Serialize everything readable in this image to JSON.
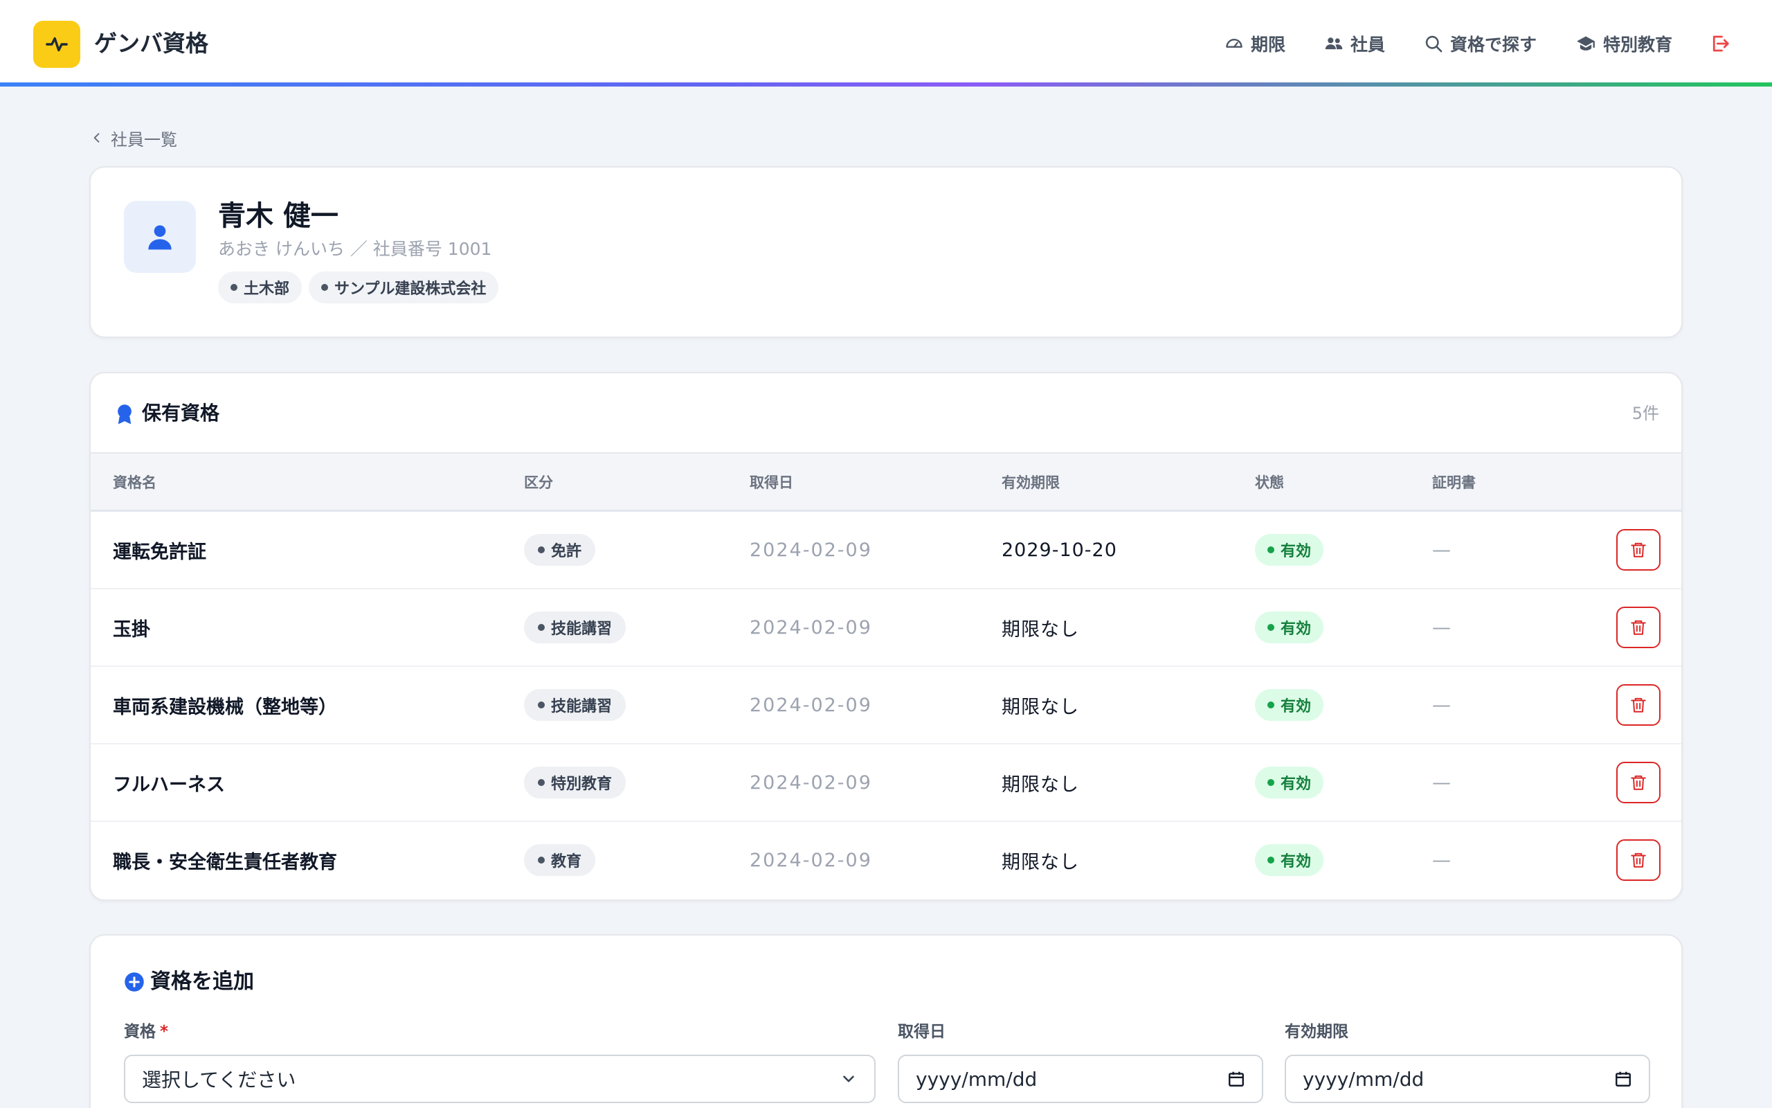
{
  "app": {
    "name": "ゲンバ資格"
  },
  "nav": {
    "items": [
      {
        "label": "期限",
        "icon": "gauge-icon"
      },
      {
        "label": "社員",
        "icon": "users-icon"
      },
      {
        "label": "資格で探す",
        "icon": "search-icon"
      },
      {
        "label": "特別教育",
        "icon": "graduation-cap-icon"
      }
    ],
    "logout_icon": "logout-icon"
  },
  "breadcrumb": {
    "back_label": "社員一覧"
  },
  "employee": {
    "name": "青木 健一",
    "subtitle": "あおき けんいち ／ 社員番号 1001",
    "tags": [
      "土木部",
      "サンプル建設株式会社"
    ]
  },
  "qualifications": {
    "title": "保有資格",
    "count": "5件",
    "columns": {
      "name": "資格名",
      "category": "区分",
      "acquired": "取得日",
      "expiry": "有効期限",
      "status": "状態",
      "certificate": "証明書"
    },
    "rows": [
      {
        "name": "運転免許証",
        "category": "免許",
        "acquired": "2024-02-09",
        "expiry": "2029-10-20",
        "status": "有効",
        "certificate": "—"
      },
      {
        "name": "玉掛",
        "category": "技能講習",
        "acquired": "2024-02-09",
        "expiry": "期限なし",
        "status": "有効",
        "certificate": "—"
      },
      {
        "name": "車両系建設機械（整地等）",
        "category": "技能講習",
        "acquired": "2024-02-09",
        "expiry": "期限なし",
        "status": "有効",
        "certificate": "—"
      },
      {
        "name": "フルハーネス",
        "category": "特別教育",
        "acquired": "2024-02-09",
        "expiry": "期限なし",
        "status": "有効",
        "certificate": "—"
      },
      {
        "name": "職長・安全衛生責任者教育",
        "category": "教育",
        "acquired": "2024-02-09",
        "expiry": "期限なし",
        "status": "有効",
        "certificate": "—"
      }
    ]
  },
  "add_form": {
    "title": "資格を追加",
    "qualification_label": "資格",
    "required_mark": "*",
    "qualification_placeholder": "選択してください",
    "acquired_label": "取得日",
    "acquired_placeholder": "yyyy/mm/dd",
    "expiry_label": "有効期限",
    "expiry_placeholder": "yyyy/mm/dd"
  },
  "colors": {
    "brand_yellow": "#facc15",
    "accent_blue": "#2563eb",
    "status_green": "#15803d",
    "danger_red": "#dc2626"
  }
}
